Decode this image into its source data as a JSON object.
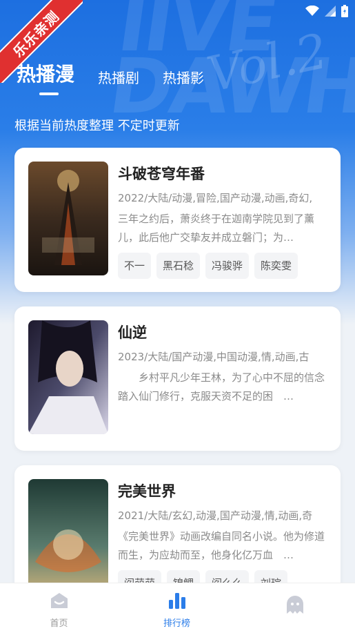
{
  "status": {
    "icons": [
      "wifi-icon",
      "signal-icon",
      "battery-icon"
    ]
  },
  "ribbon": {
    "label": "乐乐亲测"
  },
  "tabs": [
    {
      "label": "热播漫",
      "active": true
    },
    {
      "label": "热播剧",
      "active": false
    },
    {
      "label": "热播影",
      "active": false
    }
  ],
  "subtitle": "根据当前热度整理 不定时更新",
  "items": [
    {
      "title": "斗破苍穹年番",
      "meta": "2022/大陆/动漫,冒险,国产动漫,动画,奇幻,",
      "desc": "三年之约后，萧炎终于在迦南学院见到了薰儿，此后他广交挚友并成立磐门；为…",
      "tags": [
        "不一",
        "黑石稔",
        "冯骏骅",
        "陈奕雯"
      ]
    },
    {
      "title": "仙逆",
      "meta": "2023/大陆/国产动漫,中国动漫,情,动画,古",
      "desc": "　　乡村平凡少年王林，为了心中不屈的信念踏入仙门修行，克服天资不足的困　…",
      "tags": []
    },
    {
      "title": "完美世界",
      "meta": "2021/大陆/玄幻,动漫,国产动漫,情,动画,奇",
      "desc": "《完美世界》动画改编自同名小说。他为修道而生，为应劫而至，他身化亿万血　…",
      "tags": [
        "阎萌萌",
        "锦鲤",
        "阎么么",
        "刘琮"
      ]
    }
  ],
  "nav": [
    {
      "label": "首页",
      "icon": "home-icon"
    },
    {
      "label": "排行榜",
      "icon": "ranking-icon"
    },
    {
      "label": "",
      "icon": "ghost-icon"
    }
  ],
  "colors": {
    "accent": "#2b7de9",
    "ribbon": "#e03030"
  }
}
